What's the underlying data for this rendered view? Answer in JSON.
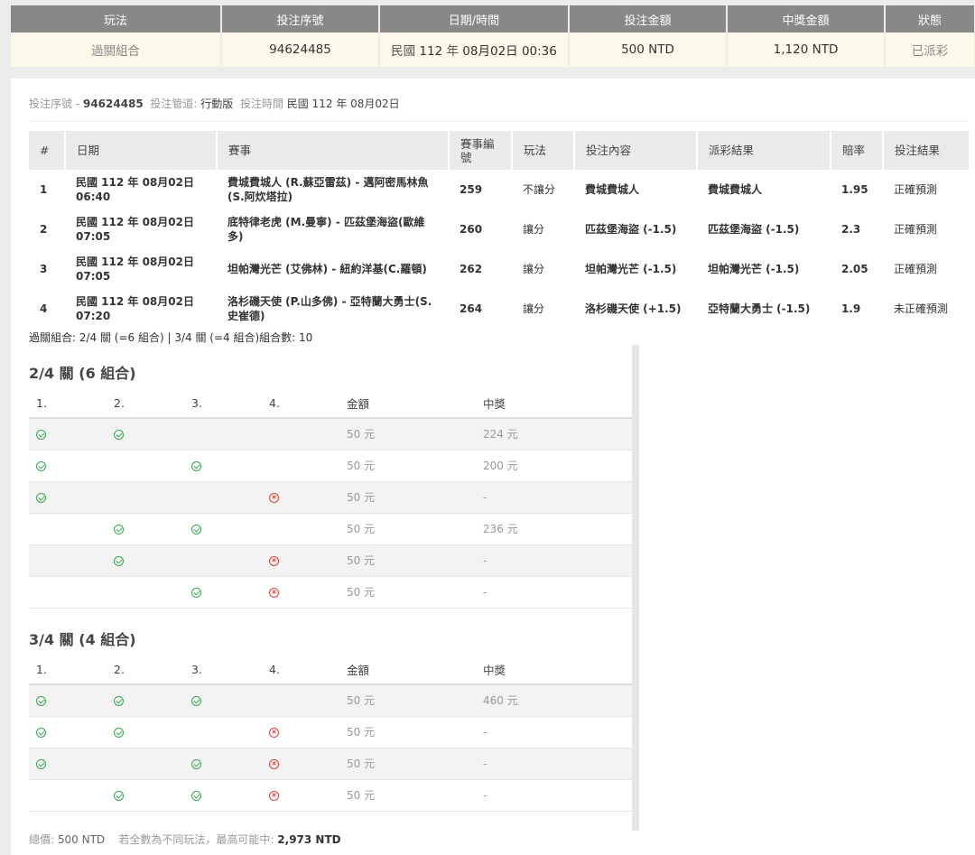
{
  "summary": {
    "headers": [
      "玩法",
      "投注序號",
      "日期/時間",
      "投注金額",
      "中獎金額",
      "狀態"
    ],
    "play": "過關組合",
    "serial": "94624485",
    "date_prefix": "民國",
    "date_year": "112",
    "date_year_unit": "年",
    "date_md": "08月02日",
    "date_time": "00:36",
    "bet_amount": "500 NTD",
    "win_amount": "1,120 NTD",
    "status": "已派彩"
  },
  "bet_info": {
    "serial_label": "投注序號 -",
    "serial": "94624485",
    "channel_label": "投注管道:",
    "channel": "行動版",
    "time_label": "投注時間",
    "time": "民國 112 年 08月02日"
  },
  "matches": {
    "headers": [
      "#",
      "日期",
      "賽事",
      "賽事編號",
      "玩法",
      "投注內容",
      "派彩結果",
      "賠率",
      "投注結果"
    ],
    "rows": [
      {
        "no": "1",
        "date": "民國 112 年 08月02日",
        "time": "06:40",
        "match": "費城費城人 (R.蘇亞雷茲) - 邁阿密馬林魚(S.阿炊塔拉)",
        "id": "259",
        "play": "不讓分",
        "content": "費城費城人",
        "payout": "費城費城人",
        "odds": "1.95",
        "result": "正確預測"
      },
      {
        "no": "2",
        "date": "民國 112 年 08月02日",
        "time": "07:05",
        "match": "底特律老虎 (M.曼寧) - 匹茲堡海盜(歐維多)",
        "id": "260",
        "play": "讓分",
        "content": "匹茲堡海盜 (-1.5)",
        "payout": "匹茲堡海盜 (-1.5)",
        "odds": "2.3",
        "result": "正確預測"
      },
      {
        "no": "3",
        "date": "民國 112 年 08月02日",
        "time": "07:05",
        "match": "坦帕灣光芒 (艾佛林) - 紐約洋基(C.羅頓)",
        "id": "262",
        "play": "讓分",
        "content": "坦帕灣光芒 (-1.5)",
        "payout": "坦帕灣光芒 (-1.5)",
        "odds": "2.05",
        "result": "正確預測"
      },
      {
        "no": "4",
        "date": "民國 112 年 08月02日",
        "time": "07:20",
        "match": "洛杉磯天使 (P.山多佛) - 亞特蘭大勇士(S.史崔德)",
        "id": "264",
        "play": "讓分",
        "content": "洛杉磯天使 (+1.5)",
        "payout": "亞特蘭大勇士 (-1.5)",
        "odds": "1.9",
        "result": "未正確預測"
      }
    ]
  },
  "combo_summary": "過關組合: 2/4 關 (=6 組合) | 3/4 關 (=4 組合)組合數: 10",
  "combo_headers": [
    "1.",
    "2.",
    "3.",
    "4.",
    "金額",
    "中獎"
  ],
  "section_24": {
    "title": "2/4 關 (6 組合)",
    "rows": [
      {
        "legs": [
          "ok",
          "ok",
          "",
          ""
        ],
        "amount": "50 元",
        "prize": "224 元"
      },
      {
        "legs": [
          "ok",
          "",
          "ok",
          ""
        ],
        "amount": "50 元",
        "prize": "200 元"
      },
      {
        "legs": [
          "ok",
          "",
          "",
          "no"
        ],
        "amount": "50 元",
        "prize": "-"
      },
      {
        "legs": [
          "",
          "ok",
          "ok",
          ""
        ],
        "amount": "50 元",
        "prize": "236 元"
      },
      {
        "legs": [
          "",
          "ok",
          "",
          "no"
        ],
        "amount": "50 元",
        "prize": "-"
      },
      {
        "legs": [
          "",
          "",
          "ok",
          "no"
        ],
        "amount": "50 元",
        "prize": "-"
      }
    ]
  },
  "section_34": {
    "title": "3/4 關 (4 組合)",
    "rows": [
      {
        "legs": [
          "ok",
          "ok",
          "ok",
          ""
        ],
        "amount": "50 元",
        "prize": "460 元"
      },
      {
        "legs": [
          "ok",
          "ok",
          "",
          "no"
        ],
        "amount": "50 元",
        "prize": "-"
      },
      {
        "legs": [
          "ok",
          "",
          "ok",
          "no"
        ],
        "amount": "50 元",
        "prize": "-"
      },
      {
        "legs": [
          "",
          "ok",
          "ok",
          "no"
        ],
        "amount": "50 元",
        "prize": "-"
      }
    ]
  },
  "footer": {
    "total_label": "總價:",
    "total": "500 NTD",
    "max_label": "若全數為不同玩法，最高可能中:",
    "max": "2,973 NTD"
  },
  "icons": {
    "ok": "check-circle-icon",
    "no": "cross-circle-icon"
  },
  "colors": {
    "ok": "#3aa553",
    "no": "#d9443b",
    "header_bg": "#888888",
    "summary_row_bg": "#fcf9ea"
  }
}
